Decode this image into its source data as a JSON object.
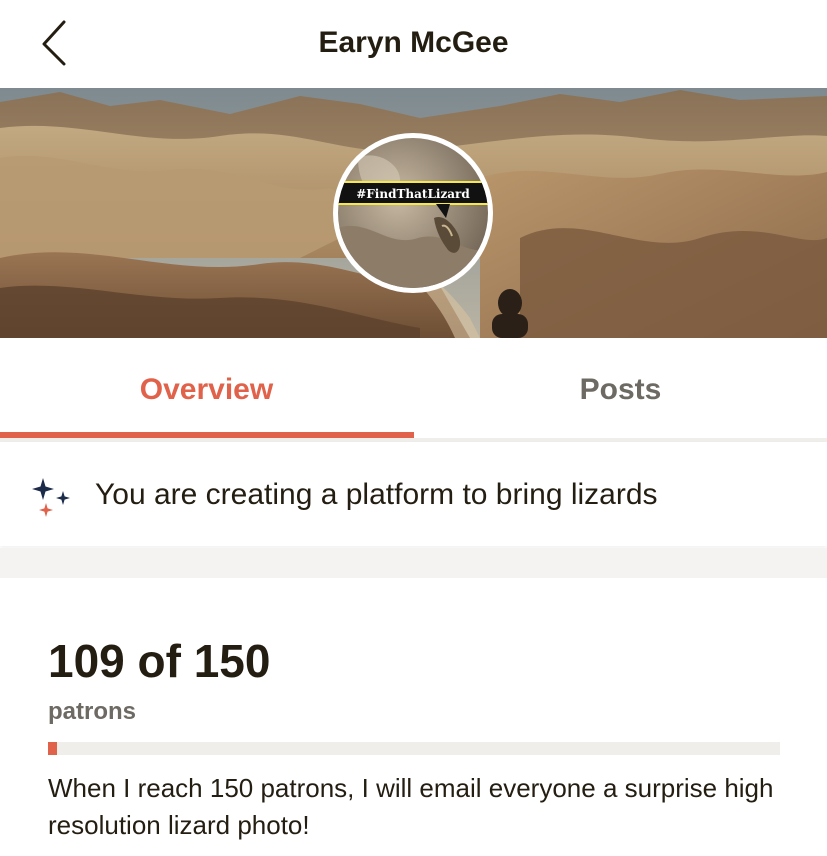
{
  "header": {
    "title": "Earyn McGee",
    "back_icon": "chevron-left-icon"
  },
  "cover": {
    "image": "desert-badlands-photo",
    "avatar_text": "#FindThatLizard"
  },
  "tabs": [
    {
      "label": "Overview",
      "active": true
    },
    {
      "label": "Posts",
      "active": false
    }
  ],
  "banner": {
    "icon": "sparkle-icon",
    "text": "You are creating a platform to bring lizards"
  },
  "goal": {
    "count_text": "109 of 150",
    "unit": "patrons",
    "progress_fraction": 0.012,
    "description": "When I reach 150 patrons, I will email everyone a surprise high resolution lizard photo!"
  },
  "colors": {
    "accent": "#e0624a",
    "text": "#241e12",
    "muted": "#6d6963",
    "track": "#f0eeeb"
  }
}
